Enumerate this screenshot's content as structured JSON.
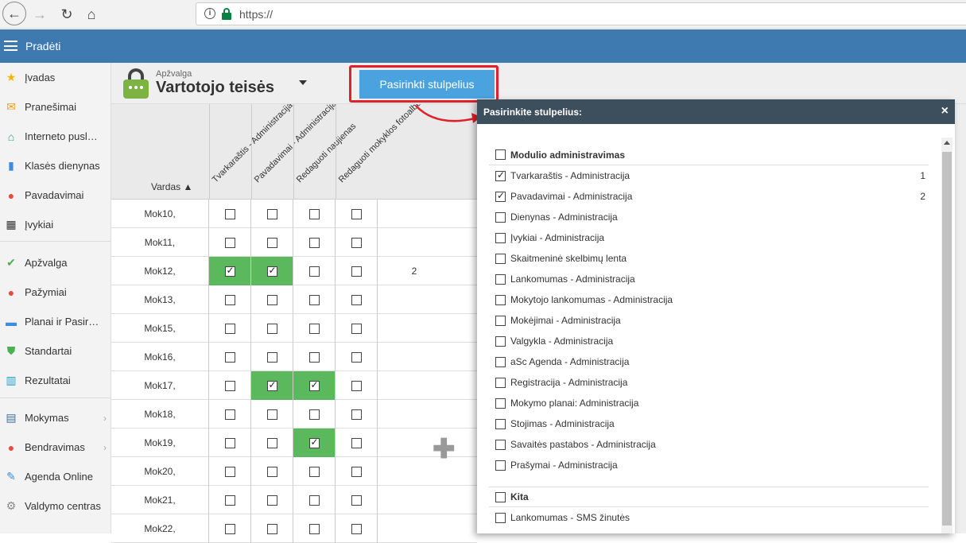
{
  "browser": {
    "url": "https://"
  },
  "appbar": {
    "start_label": "Pradėti"
  },
  "sidebar": {
    "items": [
      {
        "label": "Įvadas",
        "icon": "star-icon",
        "color": "#f4b400"
      },
      {
        "label": "Pranešimai",
        "icon": "envelope-icon",
        "color": "#f39c12"
      },
      {
        "label": "Interneto pusl…",
        "icon": "house-icon",
        "color": "#27a085"
      },
      {
        "label": "Klasės dienynas",
        "icon": "book-icon",
        "color": "#3c8dde"
      },
      {
        "label": "Pavadavimai",
        "icon": "person-icon",
        "color": "#e74c3c"
      },
      {
        "label": "Įvykiai",
        "icon": "calendar-icon",
        "color": "#333333"
      },
      {
        "label": "Apžvalga",
        "icon": "check-circle-icon",
        "color": "#4caf50"
      },
      {
        "label": "Pažymiai",
        "icon": "grade-icon",
        "color": "#e74c3c"
      },
      {
        "label": "Planai ir Pasir…",
        "icon": "briefcase-icon",
        "color": "#3c8dde"
      },
      {
        "label": "Standartai",
        "icon": "shield-icon",
        "color": "#4caf50"
      },
      {
        "label": "Rezultatai",
        "icon": "bar-chart-icon",
        "color": "#27a0c8"
      },
      {
        "label": "Mokymas",
        "icon": "open-book-icon",
        "color": "#3c6ea0",
        "chevron": "›"
      },
      {
        "label": "Bendravimas",
        "icon": "chat-icon",
        "color": "#e74c3c",
        "chevron": "›"
      },
      {
        "label": "Agenda Online",
        "icon": "feather-icon",
        "color": "#3c8dde"
      },
      {
        "label": "Valdymo centras",
        "icon": "gear-icon",
        "color": "#888888"
      }
    ]
  },
  "header": {
    "subtitle": "Apžvalga",
    "title": "Vartotojo teisės",
    "pick_button": "Pasirinkti stulpelius"
  },
  "grid": {
    "name_header": "Vardas ▲",
    "columns": [
      "Tvarkaraštis - Administracija",
      "Pavadavimai - Administracija",
      "Redaguoti naujienas",
      "Redaguoti mokyklos fotoalbumą"
    ],
    "rows": [
      {
        "name": "Mok10,",
        "checks": [
          false,
          false,
          false,
          false
        ],
        "count": ""
      },
      {
        "name": "Mok11,",
        "checks": [
          false,
          false,
          false,
          false
        ],
        "count": ""
      },
      {
        "name": "Mok12,",
        "checks": [
          true,
          true,
          false,
          false
        ],
        "count": "2"
      },
      {
        "name": "Mok13,",
        "checks": [
          false,
          false,
          false,
          false
        ],
        "count": ""
      },
      {
        "name": "Mok15,",
        "checks": [
          false,
          false,
          false,
          false
        ],
        "count": ""
      },
      {
        "name": "Mok16,",
        "checks": [
          false,
          false,
          false,
          false
        ],
        "count": ""
      },
      {
        "name": "Mok17,",
        "checks": [
          false,
          true,
          true,
          false
        ],
        "count": ""
      },
      {
        "name": "Mok18,",
        "checks": [
          false,
          false,
          false,
          false
        ],
        "count": ""
      },
      {
        "name": "Mok19,",
        "checks": [
          false,
          false,
          true,
          false
        ],
        "count": ""
      },
      {
        "name": "Mok20,",
        "checks": [
          false,
          false,
          false,
          false
        ],
        "count": ""
      },
      {
        "name": "Mok21,",
        "checks": [
          false,
          false,
          false,
          false
        ],
        "count": ""
      },
      {
        "name": "Mok22,",
        "checks": [
          false,
          false,
          false,
          false
        ],
        "count": ""
      }
    ]
  },
  "panel": {
    "title": "Pasirinkite stulpelius:",
    "close": "×",
    "items": [
      {
        "label": "Modulio administravimas",
        "checked": false,
        "group": true,
        "num": ""
      },
      {
        "label": "Tvarkaraštis - Administracija",
        "checked": true,
        "num": "1"
      },
      {
        "label": "Pavadavimai - Administracija",
        "checked": true,
        "num": "2"
      },
      {
        "label": "Dienynas - Administracija",
        "checked": false,
        "num": ""
      },
      {
        "label": "Įvykiai - Administracija",
        "checked": false,
        "num": ""
      },
      {
        "label": "Skaitmeninė skelbimų lenta",
        "checked": false,
        "num": ""
      },
      {
        "label": "Lankomumas - Administracija",
        "checked": false,
        "num": ""
      },
      {
        "label": "Mokytojo lankomumas - Administracija",
        "checked": false,
        "num": ""
      },
      {
        "label": "Mokėjimai - Administracija",
        "checked": false,
        "num": ""
      },
      {
        "label": "Valgykla - Administracija",
        "checked": false,
        "num": ""
      },
      {
        "label": "aSc Agenda - Administracija",
        "checked": false,
        "num": ""
      },
      {
        "label": "Registracija - Administracija",
        "checked": false,
        "num": ""
      },
      {
        "label": "Mokymo planai: Administracija",
        "checked": false,
        "num": ""
      },
      {
        "label": "Stojimas - Administracija",
        "checked": false,
        "num": ""
      },
      {
        "label": "Savaitės pastabos - Administracija",
        "checked": false,
        "num": ""
      },
      {
        "label": "Prašymai - Administracija",
        "checked": false,
        "num": ""
      },
      {
        "label": "Kita",
        "checked": false,
        "group": true,
        "num": ""
      },
      {
        "label": "Lankomumas - SMS žinutės",
        "checked": false,
        "num": ""
      }
    ]
  },
  "colors": {
    "accent": "#3e7ab0",
    "checked_cell": "#5cb85c",
    "button": "#4aa3df",
    "highlight": "#e0202a"
  }
}
